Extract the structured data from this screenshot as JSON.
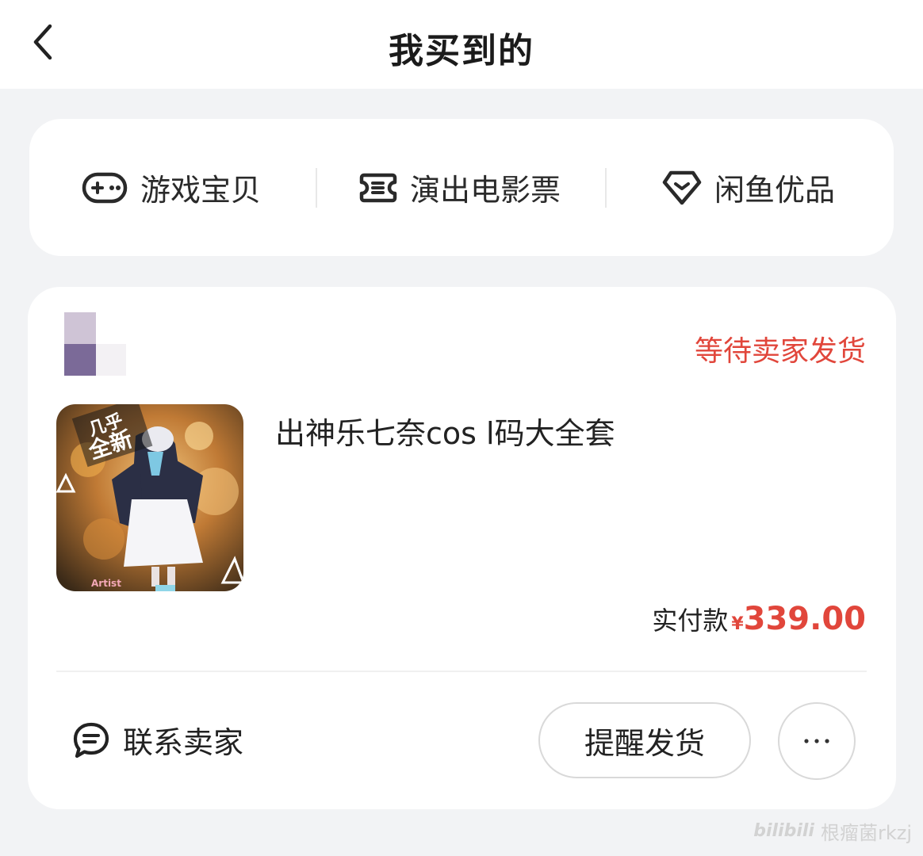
{
  "header": {
    "title": "我买到的",
    "back_icon": "chevron-left-icon"
  },
  "categories": [
    {
      "label": "游戏宝贝",
      "icon": "gamepad-icon"
    },
    {
      "label": "演出电影票",
      "icon": "ticket-icon"
    },
    {
      "label": "闲鱼优品",
      "icon": "diamond-icon"
    }
  ],
  "order": {
    "status": "等待卖家发货",
    "product": {
      "title": "出神乐七奈cos l码大全套",
      "image_badge": "几乎全新",
      "image_tag": "Artist"
    },
    "payment": {
      "label": "实付款",
      "currency": "¥",
      "amount": "339.00"
    },
    "actions": {
      "contact_seller": "联系卖家",
      "remind_shipping": "提醒发货",
      "more": "···"
    }
  },
  "watermark": {
    "logo": "bilibili",
    "text": "根瘤菌rkzj"
  },
  "colors": {
    "accent": "#e1463b",
    "background": "#f2f3f5",
    "card": "#ffffff"
  }
}
